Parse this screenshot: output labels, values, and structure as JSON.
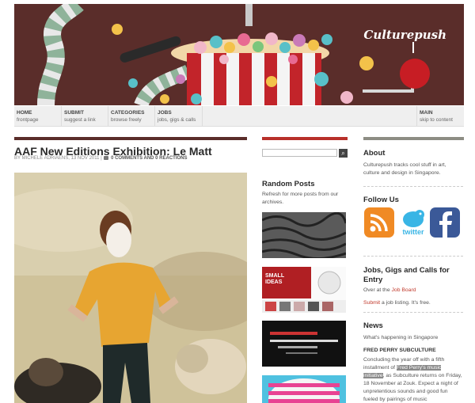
{
  "header": {
    "brand": "Culturepush"
  },
  "nav": [
    {
      "title": "HOME",
      "sub": "frontpage"
    },
    {
      "title": "SUBMIT",
      "sub": "suggest a link"
    },
    {
      "title": "CATEGORIES",
      "sub": "browse freely"
    },
    {
      "title": "JOBS",
      "sub": "jobs, gigs & calls"
    },
    {
      "title": "MAIN",
      "sub": "skip to content"
    }
  ],
  "article": {
    "title": "AAF New Editions Exhibition: Le Matt",
    "byline": "BY MICHELE ADRIAENS, 13 NOV 2011 |",
    "comments": "0 COMMENTS AND 0 REACTIONS"
  },
  "sidebar_mid": {
    "search_button": "⌕",
    "random_title": "Random Posts",
    "random_desc": "Refresh for more posts from our archives.",
    "thumb2_text": "SMALL IDEAS"
  },
  "sidebar_right": {
    "about_title": "About",
    "about_text": "Culturepush tracks cool stuff in art, culture and design in Singapore.",
    "follow_title": "Follow Us",
    "twitter_text": "twitter",
    "jobs_title": "Jobs, Gigs and Calls for Entry",
    "jobs_line1_pre": "Over at the",
    "jobs_line1_link": "Job Board",
    "jobs_line2_link": "Submit",
    "jobs_line2_post": "a job listing. It's free.",
    "news_title": "News",
    "news_sub": "What's happening in Singapore",
    "news_headline": "FRED PERRY SUBCULTURE",
    "news_p1": "Concluding the year off with a fifth installment of",
    "news_hl": "Fred Perry's music initiative",
    "news_p2": ", as Subculture returns on Friday, 18 November at Zouk. Expect a night of unpretentious sounds and good fun fueled by pairings of music"
  },
  "colors": {
    "accent_dark": "#5a2d2a",
    "accent_red": "#b8302a",
    "accent_grey": "#8d8d84"
  }
}
